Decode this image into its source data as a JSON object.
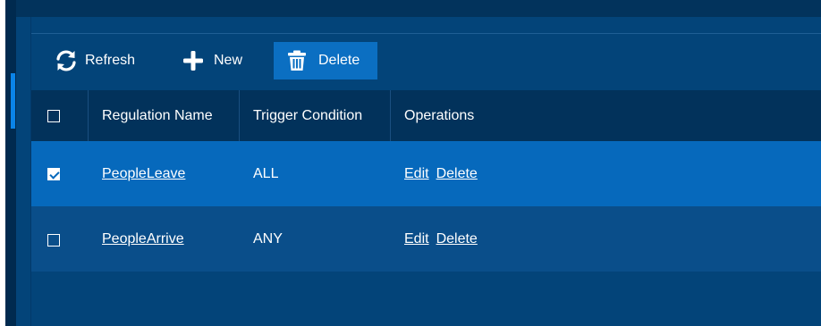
{
  "toolbar": {
    "refresh_label": "Refresh",
    "new_label": "New",
    "delete_label": "Delete"
  },
  "table": {
    "headers": {
      "select_all": "",
      "regulation_name": "Regulation Name",
      "trigger_condition": "Trigger Condition",
      "operations": "Operations"
    },
    "rows": [
      {
        "checked": true,
        "name": "PeopleLeave",
        "trigger": "ALL",
        "edit": "Edit",
        "delete": "Delete"
      },
      {
        "checked": false,
        "name": "PeopleArrive",
        "trigger": "ANY",
        "edit": "Edit",
        "delete": "Delete"
      }
    ]
  },
  "colors": {
    "panel_bg": "#034479",
    "header_bg": "#02325b",
    "selected_row_bg": "#0669bc",
    "row_bg": "#0a4e8a",
    "delete_button_bg": "#0b6fc2",
    "accent": "#0a84e8"
  },
  "icons": {
    "refresh": "refresh-icon",
    "new": "plus-icon",
    "delete": "trash-icon"
  }
}
